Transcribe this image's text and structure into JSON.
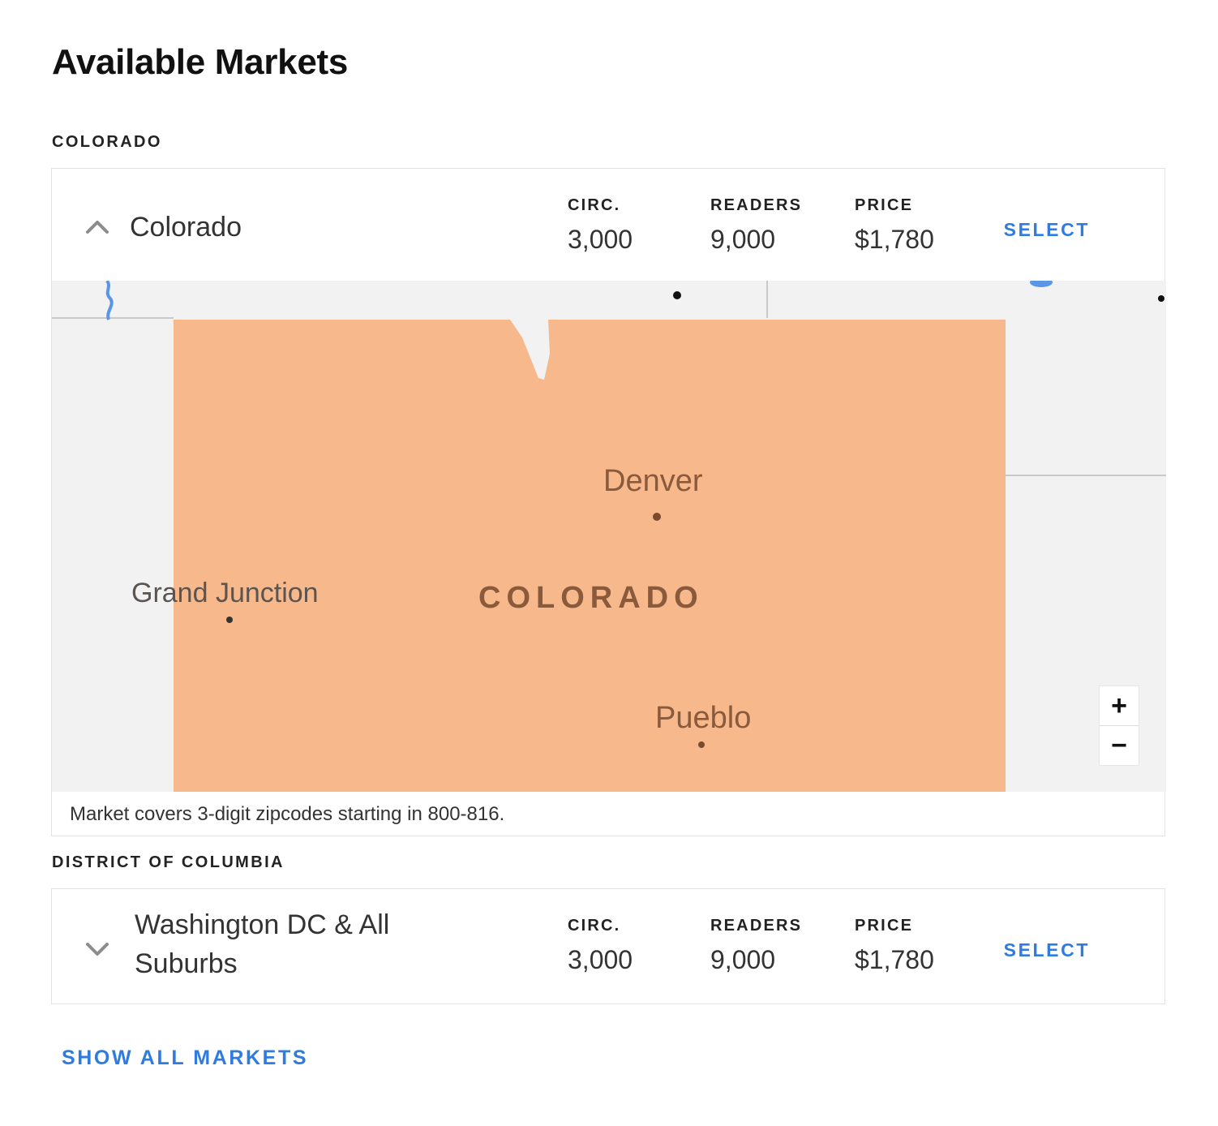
{
  "page": {
    "title": "Available Markets"
  },
  "stat_labels": {
    "circ": "CIRC.",
    "readers": "READERS",
    "price": "PRICE"
  },
  "sections": [
    {
      "heading": "COLORADO",
      "market": {
        "name": "Colorado",
        "expanded": true,
        "circ": "3,000",
        "readers": "9,000",
        "price": "$1,780",
        "select_label": "SELECT",
        "map": {
          "state_label": "COLORADO",
          "cities": [
            "Denver",
            "Grand Junction",
            "Pueblo"
          ],
          "zoom_in": "+",
          "zoom_out": "−",
          "highlight_color": "#f7b98c",
          "note": "Market covers 3-digit zipcodes starting in 800-816."
        }
      }
    },
    {
      "heading": "DISTRICT OF COLUMBIA",
      "market": {
        "name": "Washington DC & All Suburbs",
        "expanded": false,
        "circ": "3,000",
        "readers": "9,000",
        "price": "$1,780",
        "select_label": "SELECT"
      }
    }
  ],
  "footer": {
    "show_all_label": "SHOW ALL MARKETS"
  },
  "colors": {
    "accent": "#2f7be0",
    "map_background": "#f2f2f2"
  }
}
